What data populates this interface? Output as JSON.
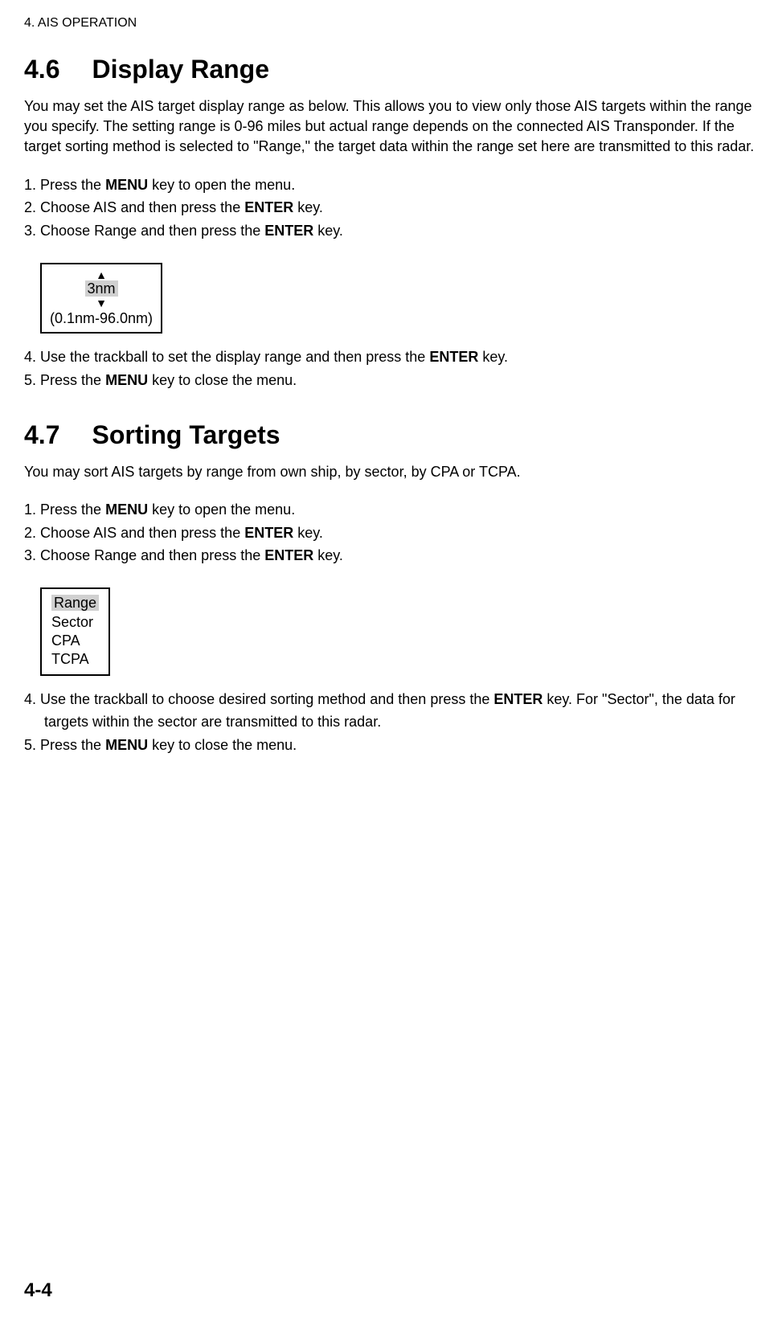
{
  "header": {
    "chapter": "4. AIS OPERATION"
  },
  "section46": {
    "number": "4.6",
    "title": "Display Range",
    "intro": "You may set the AIS target display range as below. This allows you to view only those AIS targets within the range you specify. The setting range is 0-96 miles but actual range depends on the connected AIS Transponder. If the target sorting method is selected to \"Range,\" the target data within the range set here are transmitted to this radar.",
    "steps_a": [
      {
        "num": "1.",
        "pre": "Press the ",
        "bold": "MENU",
        "post": " key to open the menu."
      },
      {
        "num": "2.",
        "pre": "Choose AIS and then press the ",
        "bold": "ENTER",
        "post": " key."
      },
      {
        "num": "3.",
        "pre": "Choose Range and then press the ",
        "bold": "ENTER",
        "post": " key."
      }
    ],
    "figure": {
      "value": "3nm",
      "limits": "(0.1nm-96.0nm)"
    },
    "steps_b": [
      {
        "num": "4.",
        "pre": "Use the trackball to set the display range and then press the ",
        "bold": "ENTER",
        "post": " key."
      },
      {
        "num": "5.",
        "pre": "Press the ",
        "bold": "MENU",
        "post": " key to close the menu."
      }
    ]
  },
  "section47": {
    "number": "4.7",
    "title": "Sorting Targets",
    "intro": "You may sort AIS targets by range from own ship, by sector, by CPA or TCPA.",
    "steps_a": [
      {
        "num": "1.",
        "pre": "Press the ",
        "bold": "MENU",
        "post": " key to open the menu."
      },
      {
        "num": "2.",
        "pre": "Choose AIS and then press the ",
        "bold": "ENTER",
        "post": " key."
      },
      {
        "num": "3.",
        "pre": "Choose Range and then press the ",
        "bold": "ENTER",
        "post": " key."
      }
    ],
    "figure": {
      "options": [
        "Range",
        "Sector",
        "CPA",
        "TCPA"
      ]
    },
    "steps_b": [
      {
        "num": "4.",
        "pre": "Use the trackball to choose desired sorting method and then press the ",
        "bold": "ENTER",
        "post": " key. For \"Sector\", the data for targets within the sector are transmitted to this radar."
      },
      {
        "num": "5.",
        "pre": "Press the ",
        "bold": "MENU",
        "post": " key to close the menu."
      }
    ]
  },
  "footer": {
    "page": "4-4"
  }
}
